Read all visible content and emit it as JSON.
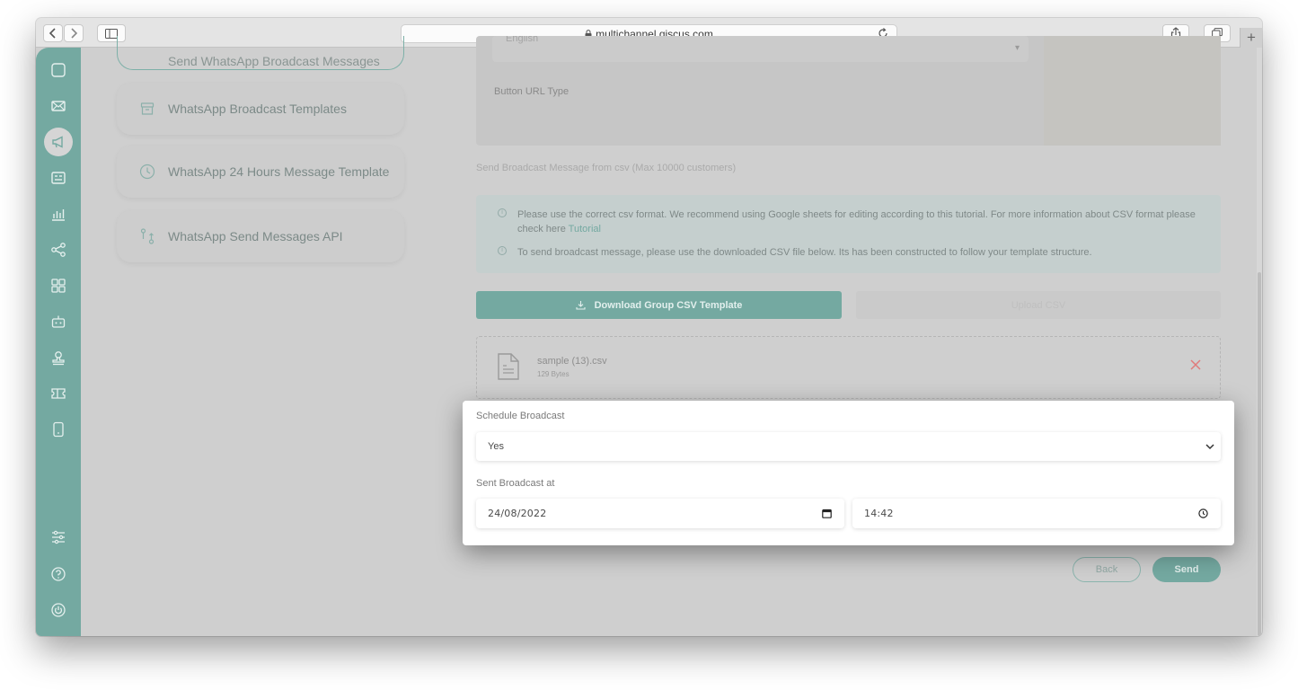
{
  "browser": {
    "url": "multichannel.qiscus.com",
    "back_icon": "chevron-left-icon",
    "forward_icon": "chevron-right-icon",
    "new_tab_label": "+"
  },
  "sidebar": {
    "icons": [
      "inbox-icon",
      "mail-icon",
      "broadcast-megaphone-icon",
      "contacts-card-icon",
      "analytics-chart-icon",
      "integration-share-icon",
      "apps-grid-icon",
      "bot-icon",
      "agent-stamp-icon",
      "ticket-icon",
      "mobile-icon",
      "settings-sliders-icon",
      "help-icon",
      "power-icon"
    ],
    "active": "broadcast-megaphone-icon"
  },
  "menu": {
    "top_item": "Send WhatsApp Broadcast Messages",
    "items": [
      {
        "label": "WhatsApp Broadcast Templates",
        "icon": "archive-icon"
      },
      {
        "label": "WhatsApp 24 Hours Message Template",
        "icon": "clock-icon"
      },
      {
        "label": "WhatsApp Send Messages API",
        "icon": "api-flow-icon"
      }
    ]
  },
  "form": {
    "language_value": "English",
    "button_url_type_label": "Button URL Type",
    "csv_section_label": "Send Broadcast Message from csv (Max 10000 customers)",
    "info_1": "Please use the correct csv format. We recommend using Google sheets for editing according to this tutorial. For more information about CSV format please check here ",
    "info_1_link": "Tutorial",
    "info_2": "To send broadcast message, please use the downloaded CSV file below. Its has been constructed to follow your template structure.",
    "download_button": "Download Group CSV Template",
    "upload_button": "Upload CSV",
    "file_name": "sample (13).csv",
    "file_size": "129 Bytes",
    "back_button": "Back",
    "send_button": "Send"
  },
  "schedule": {
    "label": "Schedule Broadcast",
    "selected": "Yes",
    "sent_at_label": "Sent Broadcast at",
    "date_value": "24/08/2022",
    "time_value": "14:42"
  },
  "colors": {
    "accent": "#74a9a1",
    "remove": "#e07b7b"
  }
}
